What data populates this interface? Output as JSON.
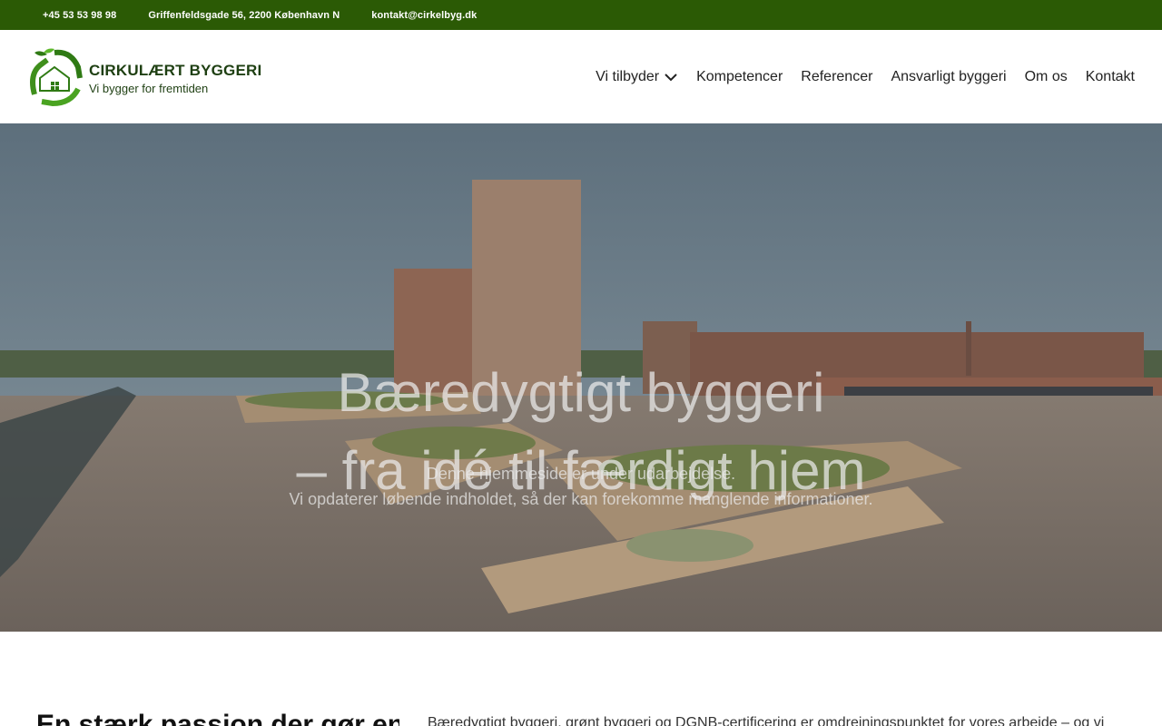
{
  "topbar": {
    "phone": "+45 53 53 98 98",
    "address": "Griffenfeldsgade 56, 2200 København N",
    "email": "kontakt@cirkelbyg.dk",
    "background": "#2b5a05"
  },
  "logo": {
    "title": "CIRKULÆRT BYGGERI",
    "tagline": "Vi bygger for fremtiden",
    "icon": "recycle-house-icon"
  },
  "nav": {
    "items": [
      {
        "label": "Vi tilbyder",
        "has_dropdown": true
      },
      {
        "label": "Kompetencer"
      },
      {
        "label": "Referencer"
      },
      {
        "label": "Ansvarligt byggeri"
      },
      {
        "label": "Om os"
      },
      {
        "label": "Kontakt"
      }
    ]
  },
  "hero": {
    "heading_line1": "Bæredygtigt byggeri",
    "heading_line2": "– fra idé til færdigt hjem",
    "notice_line1": "Denne hjemmeside er under udarbejdelse.",
    "notice_line2": "Vi opdaterer løbende indholdet, så der kan forekomme manglende informationer."
  },
  "intro": {
    "heading": "En stærk passion der gør en",
    "text": "Bæredygtigt byggeri, grønt byggeri og DGNB-certificering er omdrejningspunktet for vores arbejde – og vi"
  }
}
